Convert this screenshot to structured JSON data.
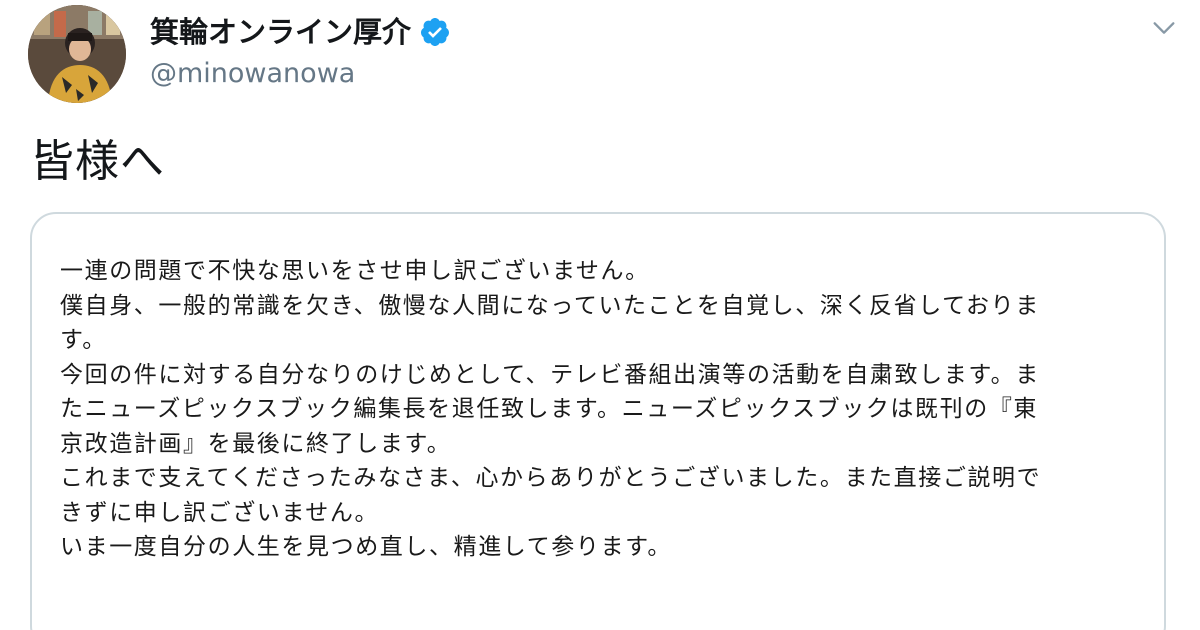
{
  "user": {
    "display_name": "箕輪オンライン厚介",
    "handle": "@minowanowa",
    "verified": true,
    "avatar_icon": "user-avatar",
    "verified_icon": "verified-badge-icon",
    "menu_icon": "chevron-down-icon"
  },
  "tweet": {
    "text": "皆様へ"
  },
  "image": {
    "lines": [
      "一連の問題で不快な思いをさせ申し訳ございません。",
      "僕自身、一般的常識を欠き、傲慢な人間になっていたことを自覚し、深く反省しておりま",
      "す。",
      "今回の件に対する自分なりのけじめとして、テレビ番組出演等の活動を自粛致します。ま",
      "たニューズピックスブック編集長を退任致します。ニューズピックスブックは既刊の『東",
      "京改造計画』を最後に終了します。",
      "これまで支えてくださったみなさま、心からありがとうございました。また直接ご説明で",
      "きずに申し訳ございません。",
      "いま一度自分の人生を見つめ直し、精進して参ります。"
    ]
  },
  "colors": {
    "verified_blue": "#1da1f2",
    "handle_gray": "#657786",
    "text": "#14171a",
    "card_border": "#cfd9de"
  }
}
